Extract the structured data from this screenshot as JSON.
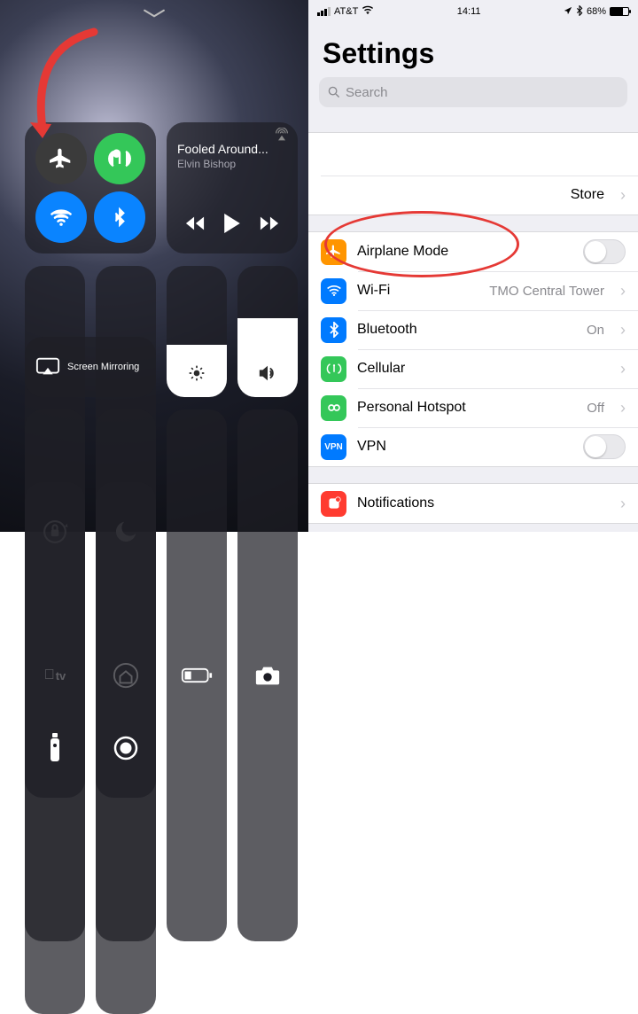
{
  "control_center": {
    "network": {
      "airplane_mode": "off",
      "cellular": "on",
      "wifi": "on",
      "bluetooth": "on"
    },
    "music": {
      "title": "Fooled Around...",
      "artist": "Elvin Bishop"
    },
    "mirroring_label": "Screen Mirroring",
    "brightness_pct": 40,
    "volume_pct": 60
  },
  "settings": {
    "statusbar": {
      "carrier": "AT&T",
      "time": "14:11",
      "battery_pct": "68%",
      "battery_fill": 68
    },
    "title": "Settings",
    "search_placeholder": "Search",
    "store_row": {
      "label": "Store"
    },
    "rows": {
      "airplane": {
        "label": "Airplane Mode",
        "color": "#ff9500"
      },
      "wifi": {
        "label": "Wi-Fi",
        "value": "TMO Central Tower",
        "color": "#007aff"
      },
      "bt": {
        "label": "Bluetooth",
        "value": "On",
        "color": "#007aff"
      },
      "cell": {
        "label": "Cellular",
        "color": "#34c759"
      },
      "hotspot": {
        "label": "Personal Hotspot",
        "value": "Off",
        "color": "#34c759"
      },
      "vpn": {
        "label": "VPN",
        "badge": "VPN",
        "color": "#007aff"
      },
      "notif": {
        "label": "Notifications",
        "color": "#ff3b30"
      }
    }
  },
  "annotation": {
    "arrow_target": "airplane-toggle",
    "ellipse_target": "airplane-and-wifi-rows"
  }
}
